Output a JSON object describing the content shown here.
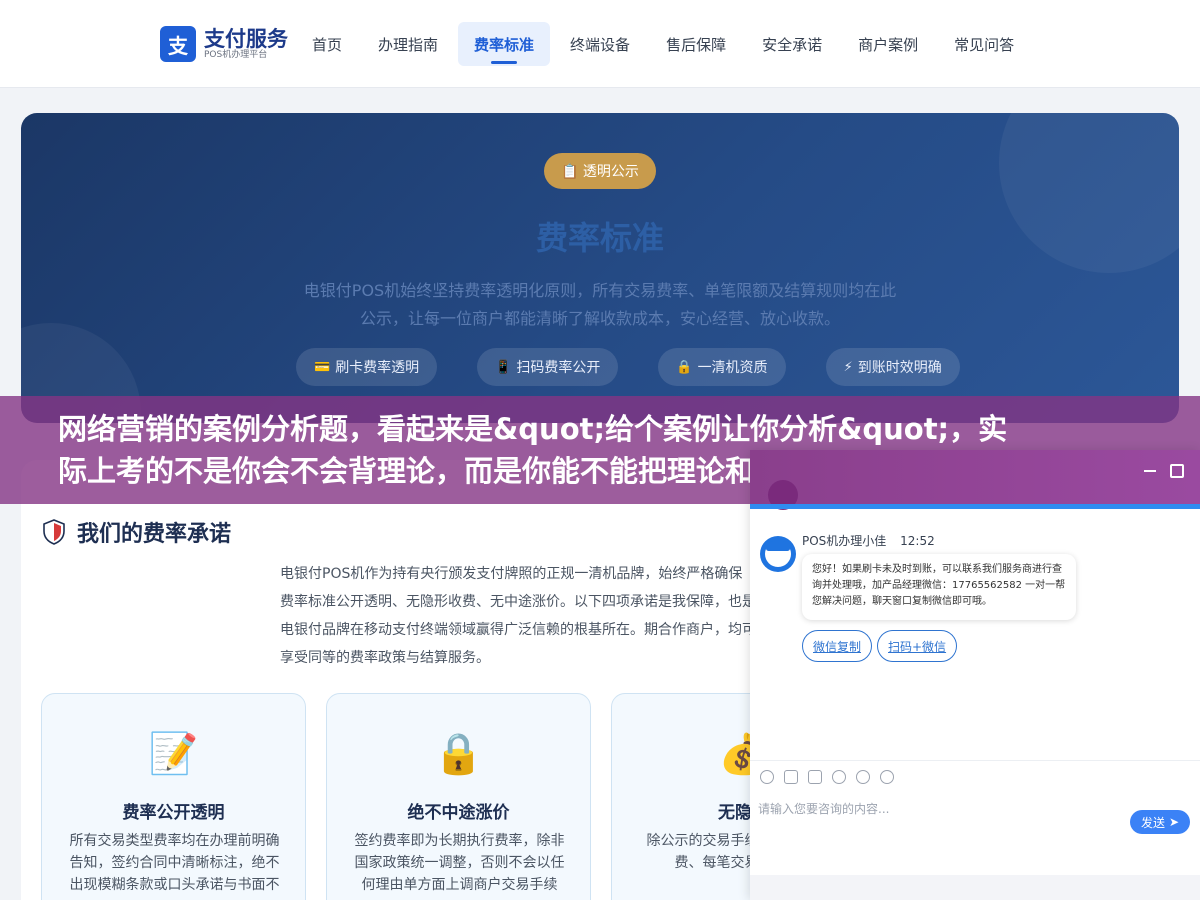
{
  "brand": {
    "mark": "支",
    "title": "支付服务",
    "subtitle": "POS机办理平台"
  },
  "nav": {
    "items": [
      {
        "label": "首页"
      },
      {
        "label": "办理指南"
      },
      {
        "label": "费率标准"
      },
      {
        "label": "终端设备"
      },
      {
        "label": "售后保障"
      },
      {
        "label": "安全承诺"
      },
      {
        "label": "商户案例"
      },
      {
        "label": "常见问答"
      }
    ],
    "active_index": 2
  },
  "hero": {
    "badge": "📋 透明公示",
    "title": "费率标准",
    "desc": "电银付POS机始终坚持费率透明化原则，所有交易费率、单笔限额及结算规则均在此公示，让每一位商户都能清晰了解收款成本，安心经营、放心收款。",
    "tags": [
      {
        "icon": "💳",
        "label": "刷卡费率透明"
      },
      {
        "icon": "📱",
        "label": "扫码费率公开"
      },
      {
        "icon": "🔒",
        "label": "一清机资质"
      },
      {
        "icon": "⚡",
        "label": "到账时效明确"
      }
    ]
  },
  "promise": {
    "title": "我们的费率承诺",
    "text": "电银付POS机作为持有央行颁发支付牌照的正规一清机品牌，始终严格确保费率标准公开透明、无隐形收费、无中途涨价。以下四项承诺是我保障，也是电银付品牌在移动支付终端领域赢得广泛信赖的根基所在。期合作商户，均可享受同等的费率政策与结算服务。",
    "cards": [
      {
        "icon": "📝",
        "title": "费率公开透明",
        "text": "所有交易类型费率均在办理前明确告知，签约合同中清晰标注，绝不出现模糊条款或口头承诺与书面不"
      },
      {
        "icon": "🔒",
        "title": "绝不中途涨价",
        "text": "签约费率即为长期执行费率，除非国家政策统一调整，否则不会以任何理由单方面上调商户交易手续"
      },
      {
        "icon": "💰",
        "title": "无隐形",
        "text": "除公示的交易手续何额外的服务费、每笔交易明细清晰"
      }
    ]
  },
  "banner": {
    "line1": "网络营销的案例分析题，看起来是&quot;给个案例让你分析&quot;，实",
    "line2": "际上考的不是你会不会背理论，而是你能不能把理论和案例对上线。很多"
  },
  "chat": {
    "agent_name": "POS机办理小佳",
    "time": "12:52",
    "message": "您好！如果刷卡未及时到账，可以联系我们服务商进行查询并处理哦，加产品经理微信：17765562582 一对一帮您解决问题，聊天窗口复制微信即可哦。",
    "quick_replies": [
      "微信复制",
      "扫码+微信"
    ],
    "input_placeholder": "请输入您要咨询的内容...",
    "send_label": "发送",
    "accent": "#2f8cf0"
  }
}
